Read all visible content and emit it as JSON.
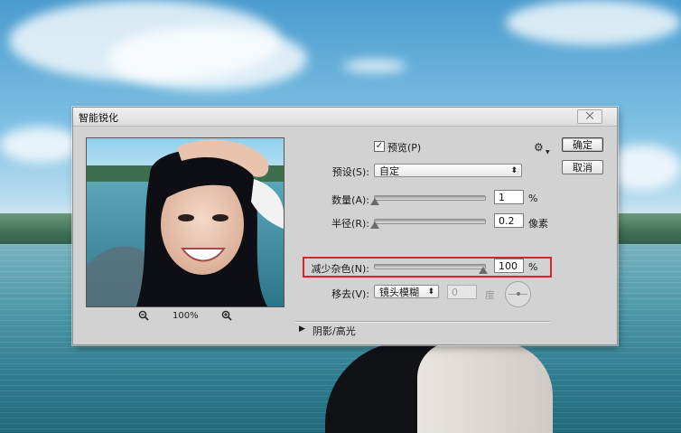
{
  "dialog": {
    "title": "智能锐化",
    "close_glyph": "⨉"
  },
  "preview": {
    "checkbox_checked": true,
    "label": "预览(P)",
    "zoom_level": "100%"
  },
  "preset": {
    "label": "预设(S):",
    "value": "自定"
  },
  "amount": {
    "label": "数量(A):",
    "value": "1",
    "unit": "%",
    "slider_fraction": 0.0
  },
  "radius": {
    "label": "半径(R):",
    "value": "0.2",
    "unit": "像素",
    "slider_fraction": 0.0
  },
  "reduce_noise": {
    "label": "减少杂色(N):",
    "value": "100",
    "unit": "%",
    "slider_fraction": 1.0
  },
  "remove": {
    "label": "移去(V):",
    "value": "镜头模糊",
    "angle_value": "0",
    "angle_unit": "度"
  },
  "shadows_highlights": {
    "label": "阴影/高光",
    "expanded": false
  },
  "buttons": {
    "ok": "确定",
    "cancel": "取消"
  },
  "colors": {
    "highlight": "#d9242c",
    "dialog_bg": "#d2d2d2"
  }
}
